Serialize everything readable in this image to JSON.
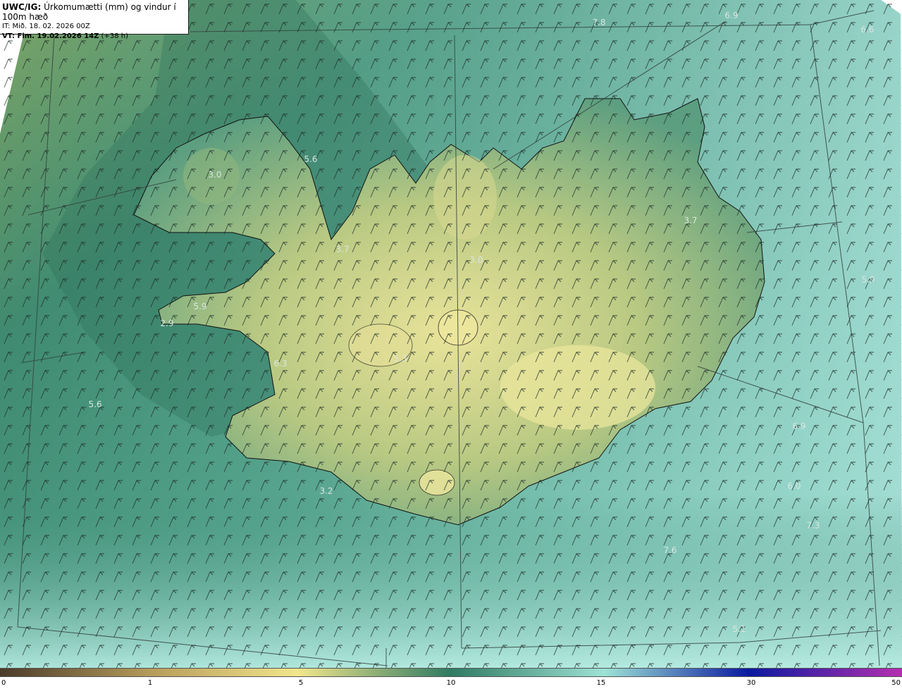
{
  "info": {
    "code": "UWC/IG:",
    "title": "Úrkomumætti (mm) og vindur í 100m hæð",
    "initial_time": "IT: Mið. 18. 02. 2026 00Z",
    "valid_prefix": "VT: Fim. 19.02.2026 14Z",
    "valid_suffix": "(+38 h)"
  },
  "value_labels": [
    {
      "text": "7.8",
      "key": "a"
    },
    {
      "text": "6.9",
      "key": "b"
    },
    {
      "text": "6.6",
      "key": "c"
    },
    {
      "text": "5.6",
      "key": "d"
    },
    {
      "text": "3.0",
      "key": "e"
    },
    {
      "text": "3.7",
      "key": "f"
    },
    {
      "text": "3.0",
      "key": "g"
    },
    {
      "text": "3.7",
      "key": "h"
    },
    {
      "text": "5.9",
      "key": "i"
    },
    {
      "text": "5.9",
      "key": "j"
    },
    {
      "text": "2.9",
      "key": "k"
    },
    {
      "text": "6.3",
      "key": "l"
    },
    {
      "text": "5.3",
      "key": "m"
    },
    {
      "text": "5.6",
      "key": "n"
    },
    {
      "text": "6.9",
      "key": "o"
    },
    {
      "text": "6.0",
      "key": "p"
    },
    {
      "text": "3.2",
      "key": "q"
    },
    {
      "text": "7.3",
      "key": "r"
    },
    {
      "text": "7.6",
      "key": "s"
    },
    {
      "text": "5.1",
      "key": "t"
    }
  ],
  "colorbar": {
    "ticks": [
      "0",
      "1",
      "5",
      "10",
      "15",
      "30",
      "50"
    ],
    "colors": [
      "#4a3b2a",
      "#b89d5b",
      "#f2e68c",
      "#2f7a62",
      "#9ee3d6",
      "#0a1aa0",
      "#b52fb0"
    ]
  },
  "layers": {
    "land_outline": "coastline",
    "wind_barbs": "wind-barbs-100m",
    "grid": "projection-graticule"
  }
}
